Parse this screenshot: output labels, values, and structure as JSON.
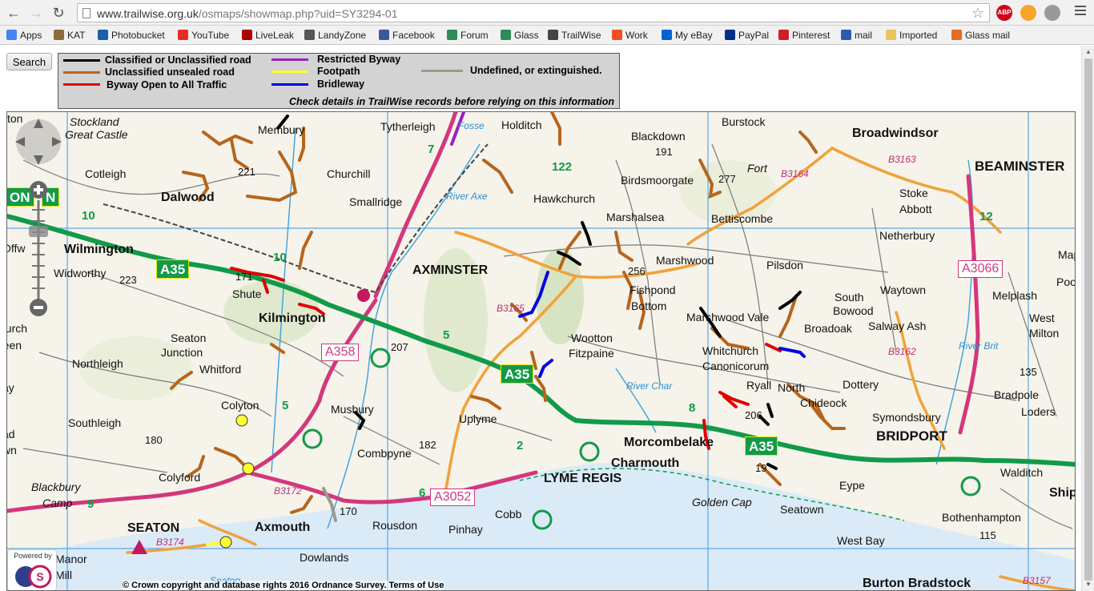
{
  "browser": {
    "url_host": "www.trailwise.org.uk",
    "url_path": "/osmaps/showmap.php?uid=SY3294-01",
    "extensions": [
      "ABP"
    ]
  },
  "bookmarks": [
    {
      "label": "Apps",
      "icon": "apps-grid-icon",
      "color": "#4285f4"
    },
    {
      "label": "KAT",
      "icon": "kat-icon",
      "color": "#8a6d3b"
    },
    {
      "label": "Photobucket",
      "icon": "photobucket-icon",
      "color": "#1a5fa8"
    },
    {
      "label": "YouTube",
      "icon": "youtube-icon",
      "color": "#e52d27"
    },
    {
      "label": "LiveLeak",
      "icon": "liveleak-icon",
      "color": "#b00000"
    },
    {
      "label": "LandyZone",
      "icon": "landyzone-icon",
      "color": "#555555"
    },
    {
      "label": "Facebook",
      "icon": "facebook-icon",
      "color": "#3b5998"
    },
    {
      "label": "Forum",
      "icon": "glass-forum-icon",
      "color": "#2e8b57"
    },
    {
      "label": "Glass",
      "icon": "glass-icon",
      "color": "#2e8b57"
    },
    {
      "label": "TrailWise",
      "icon": "trailwise-icon",
      "color": "#444444"
    },
    {
      "label": "Work",
      "icon": "windows-icon",
      "color": "#f25022"
    },
    {
      "label": "My eBay",
      "icon": "ebay-icon",
      "color": "#0064d2"
    },
    {
      "label": "PayPal",
      "icon": "paypal-icon",
      "color": "#003087"
    },
    {
      "label": "Pinterest",
      "icon": "pinterest-icon",
      "color": "#cb2027"
    },
    {
      "label": "mail",
      "icon": "mail-icon",
      "color": "#2c5cb2"
    },
    {
      "label": "Imported",
      "icon": "folder-icon",
      "color": "#e8c45a"
    },
    {
      "label": "Glass mail",
      "icon": "glass-mail-icon",
      "color": "#e56b1f"
    }
  ],
  "search_button": "Search",
  "legend": {
    "items": [
      {
        "label": "Classified or Unclassified road",
        "color": "#000000"
      },
      {
        "label": "Unclassified unsealed road",
        "color": "#b5651d"
      },
      {
        "label": "Byway Open to All Traffic",
        "color": "#e00000"
      },
      {
        "label": "Restricted Byway",
        "color": "#9b1fc8"
      },
      {
        "label": "Footpath",
        "color": "#ffff33"
      },
      {
        "label": "Bridleway",
        "color": "#0000e0"
      },
      {
        "label": "Undefined, or extinguished.",
        "color": "#9a9a8a"
      }
    ],
    "note": "Check details in TrailWise records before relying on this information"
  },
  "map": {
    "copyright": "© Crown copyright and database rights 2016 Ordnance Survey. Terms of Use",
    "powered_by": "Powered by",
    "colors": {
      "a_road": "#d3377c",
      "b_road": "#f0a23a",
      "primary": "#119a49",
      "sea": "#dbeaf7",
      "land": "#f6f3ea",
      "grid": "#5aa9e6"
    },
    "places": [
      {
        "name": "Stockland",
        "cls": "p-it"
      },
      {
        "name": "Great Castle",
        "cls": "p-it"
      },
      {
        "name": "Membury",
        "cls": "p-village"
      },
      {
        "name": "Tytherleigh",
        "cls": "p-village"
      },
      {
        "name": "Holditch",
        "cls": "p-village"
      },
      {
        "name": "Blackdown",
        "cls": "p-village"
      },
      {
        "name": "Burstock",
        "cls": "p-village"
      },
      {
        "name": "Broadwindsor",
        "cls": "p-large"
      },
      {
        "name": "BEAMINSTER",
        "cls": "p-town"
      },
      {
        "name": "Cotleigh",
        "cls": "p-village"
      },
      {
        "name": "Churchill",
        "cls": "p-village"
      },
      {
        "name": "Smallridge",
        "cls": "p-village"
      },
      {
        "name": "Dalwood",
        "cls": "p-large"
      },
      {
        "name": "Hawkchurch",
        "cls": "p-village"
      },
      {
        "name": "Birdsmoorgate",
        "cls": "p-village"
      },
      {
        "name": "Fort",
        "cls": "p-it"
      },
      {
        "name": "Bettiscombe",
        "cls": "p-village"
      },
      {
        "name": "Stoke",
        "cls": "p-village"
      },
      {
        "name": "Abbott",
        "cls": "p-village"
      },
      {
        "name": "Marshalsea",
        "cls": "p-village"
      },
      {
        "name": "Netherbury",
        "cls": "p-village"
      },
      {
        "name": "Wilmington",
        "cls": "p-large"
      },
      {
        "name": "Widworthy",
        "cls": "p-village"
      },
      {
        "name": "AXMINSTER",
        "cls": "p-large"
      },
      {
        "name": "Marshwood",
        "cls": "p-village"
      },
      {
        "name": "Pilsdon",
        "cls": "p-village"
      },
      {
        "name": "Fishpond",
        "cls": "p-village"
      },
      {
        "name": "Bottom",
        "cls": "p-village"
      },
      {
        "name": "Shute",
        "cls": "p-village"
      },
      {
        "name": "Kilmington",
        "cls": "p-large"
      },
      {
        "name": "Marshwood Vale",
        "cls": "p-village"
      },
      {
        "name": "South",
        "cls": "p-village"
      },
      {
        "name": "Bowood",
        "cls": "p-village"
      },
      {
        "name": "Waytown",
        "cls": "p-village"
      },
      {
        "name": "Melplash",
        "cls": "p-village"
      },
      {
        "name": "Seaton",
        "cls": "p-village"
      },
      {
        "name": "Junction",
        "cls": "p-village"
      },
      {
        "name": "Broadoak",
        "cls": "p-village"
      },
      {
        "name": "Salway Ash",
        "cls": "p-village"
      },
      {
        "name": "West",
        "cls": "p-village"
      },
      {
        "name": "Milton",
        "cls": "p-village"
      },
      {
        "name": "Wootton",
        "cls": "p-village"
      },
      {
        "name": "Fitzpaine",
        "cls": "p-village"
      },
      {
        "name": "Whitchurch",
        "cls": "p-village"
      },
      {
        "name": "Canonicorum",
        "cls": "p-village"
      },
      {
        "name": "Northleigh",
        "cls": "p-village"
      },
      {
        "name": "Whitford",
        "cls": "p-village"
      },
      {
        "name": "Ryall",
        "cls": "p-village"
      },
      {
        "name": "Dottery",
        "cls": "p-village"
      },
      {
        "name": "Bradpole",
        "cls": "p-village"
      },
      {
        "name": "Colyton",
        "cls": "p-village"
      },
      {
        "name": "Musbury",
        "cls": "p-village"
      },
      {
        "name": "North",
        "cls": "p-village"
      },
      {
        "name": "Chideock",
        "cls": "p-village"
      },
      {
        "name": "Symondsbury",
        "cls": "p-village"
      },
      {
        "name": "Loders",
        "cls": "p-village"
      },
      {
        "name": "Southleigh",
        "cls": "p-village"
      },
      {
        "name": "Uplyme",
        "cls": "p-village"
      },
      {
        "name": "Morcombelake",
        "cls": "p-large"
      },
      {
        "name": "BRIDPORT",
        "cls": "p-town"
      },
      {
        "name": "Combpyne",
        "cls": "p-village"
      },
      {
        "name": "Charmouth",
        "cls": "p-large"
      },
      {
        "name": "Colyford",
        "cls": "p-village"
      },
      {
        "name": "LYME REGIS",
        "cls": "p-large"
      },
      {
        "name": "Eype",
        "cls": "p-village"
      },
      {
        "name": "Walditch",
        "cls": "p-village"
      },
      {
        "name": "Blackbury",
        "cls": "p-it"
      },
      {
        "name": "Camp",
        "cls": "p-it"
      },
      {
        "name": "Golden Cap",
        "cls": "p-it"
      },
      {
        "name": "Seatown",
        "cls": "p-village"
      },
      {
        "name": "Cobb",
        "cls": "p-village"
      },
      {
        "name": "Bothenhampton",
        "cls": "p-village"
      },
      {
        "name": "SEATON",
        "cls": "p-large"
      },
      {
        "name": "Axmouth",
        "cls": "p-large"
      },
      {
        "name": "Rousdon",
        "cls": "p-village"
      },
      {
        "name": "Pinhay",
        "cls": "p-village"
      },
      {
        "name": "West Bay",
        "cls": "p-village"
      },
      {
        "name": "Dowlands",
        "cls": "p-village"
      },
      {
        "name": "Burton Bradstock",
        "cls": "p-large"
      },
      {
        "name": "Mappe",
        "cls": "p-village"
      },
      {
        "name": "Poorto",
        "cls": "p-village"
      },
      {
        "name": "Shipto",
        "cls": "p-large"
      },
      {
        "name": "Offw",
        "cls": "p-village"
      },
      {
        "name": "hurch",
        "cls": "p-village"
      },
      {
        "name": "reen",
        "cls": "p-village"
      },
      {
        "name": "ay",
        "cls": "p-village"
      },
      {
        "name": "ad",
        "cls": "p-village"
      },
      {
        "name": "wn",
        "cls": "p-village"
      },
      {
        "name": "Manor",
        "cls": "p-village"
      },
      {
        "name": "Mill",
        "cls": "p-village"
      },
      {
        "name": "ton",
        "cls": "p-village"
      }
    ],
    "spot_heights": [
      "191",
      "277",
      "221",
      "223",
      "256",
      "207",
      "171",
      "180",
      "182",
      "170",
      "206",
      "19",
      "135",
      "115"
    ],
    "road_numbers": {
      "a35": "A35",
      "a358": "A358",
      "a3052": "A3052",
      "a3066": "A3066",
      "b3172": "B3172",
      "b3174": "B3174",
      "b3165": "B3165",
      "b3164": "B3164",
      "b3163": "B3163",
      "b3162": "B3162",
      "b3157": "B3157",
      "grid_10": "10",
      "grid_7": "7",
      "grid_12": "12",
      "grid_9": "9",
      "grid_8": "8",
      "grid_6": "6",
      "grid_5": "5",
      "grid_2": "2",
      "grid_122": "122",
      "lon": "ON",
      "n": "N"
    },
    "water": [
      "River Axe",
      "River Char",
      "River Brit",
      "Fosse",
      "Seaton"
    ]
  }
}
